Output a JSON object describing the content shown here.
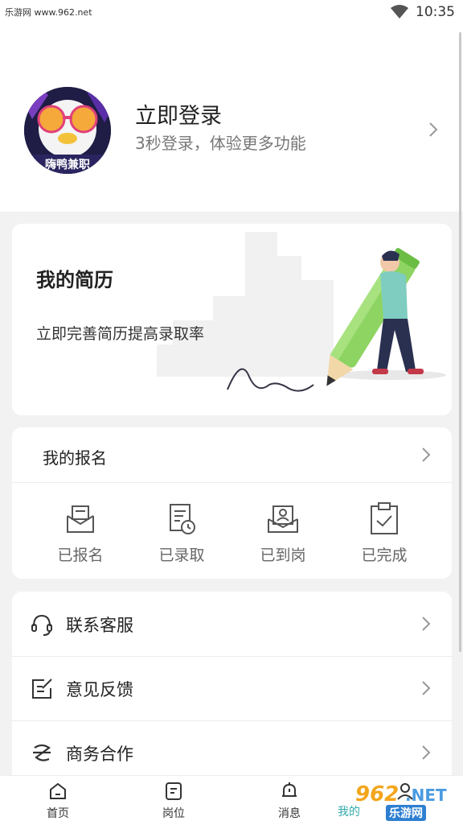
{
  "status_bar": {
    "watermark": "乐游网 www.962.net",
    "time": "10:35"
  },
  "header": {
    "avatar_text": "嗨鸭兼职",
    "login_title": "立即登录",
    "login_subtitle": "3秒登录，体验更多功能"
  },
  "resume": {
    "title": "我的简历",
    "subtitle": "立即完善简历提高录取率"
  },
  "signup": {
    "title": "我的报名",
    "statuses": [
      {
        "label": "已报名",
        "icon": "envelope-icon"
      },
      {
        "label": "已录取",
        "icon": "list-clock-icon"
      },
      {
        "label": "已到岗",
        "icon": "person-envelope-icon"
      },
      {
        "label": "已完成",
        "icon": "clipboard-check-icon"
      }
    ]
  },
  "menu": [
    {
      "label": "联系客服",
      "icon": "headset-icon"
    },
    {
      "label": "意见反馈",
      "icon": "edit-icon"
    },
    {
      "label": "商务合作",
      "icon": "handshake-icon"
    }
  ],
  "bottom_nav": [
    {
      "label": "首页",
      "icon": "home-icon"
    },
    {
      "label": "岗位",
      "icon": "job-icon"
    },
    {
      "label": "消息",
      "icon": "bell-icon"
    },
    {
      "label": "我的",
      "icon": "person-icon"
    }
  ],
  "watermark_bottom": {
    "num": "962",
    "net": ".NET",
    "cn": "乐游网",
    "partial": "我的"
  },
  "colors": {
    "accent_green": "#8ed463",
    "text_dark": "#222222",
    "text_gray": "#777777"
  }
}
